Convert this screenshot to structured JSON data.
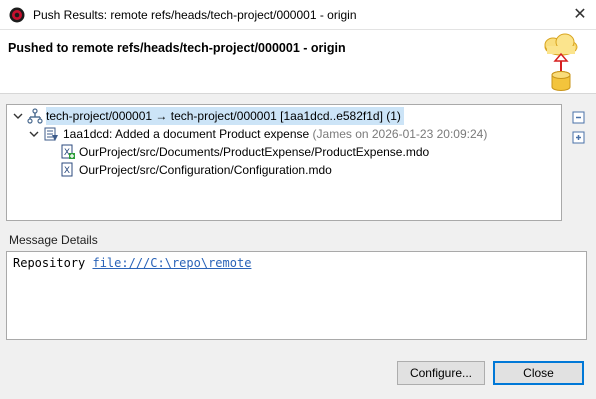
{
  "window": {
    "title": "Push Results: remote refs/heads/tech-project/000001 - origin",
    "close_symbol": "✕"
  },
  "header": {
    "title": "Pushed to remote refs/heads/tech-project/000001 - origin"
  },
  "tree": {
    "ref_row": {
      "label": "tech-project/000001 → tech-project/000001 [1aa1dcd..e582f1d] (1)",
      "icon": "push-ref-icon"
    },
    "commit_row": {
      "label": "1aa1dcd: Added a document Product expense",
      "meta": "(James on 2026-01-23 20:09:24)",
      "icon": "commit-icon"
    },
    "files": [
      {
        "path": "OurProject/src/Documents/ProductExpense/ProductExpense.mdo",
        "icon": "file-added-icon"
      },
      {
        "path": "OurProject/src/Configuration/Configuration.mdo",
        "icon": "file-modified-icon"
      }
    ]
  },
  "message_details": {
    "label": "Message Details",
    "prefix": "Repository",
    "link": "file:///C:\\repo\\remote"
  },
  "buttons": {
    "configure": "Configure...",
    "close": "Close"
  },
  "colors": {
    "selection": "#cce4f7",
    "link": "#2a63b8",
    "default_button_border": "#0078d7"
  }
}
